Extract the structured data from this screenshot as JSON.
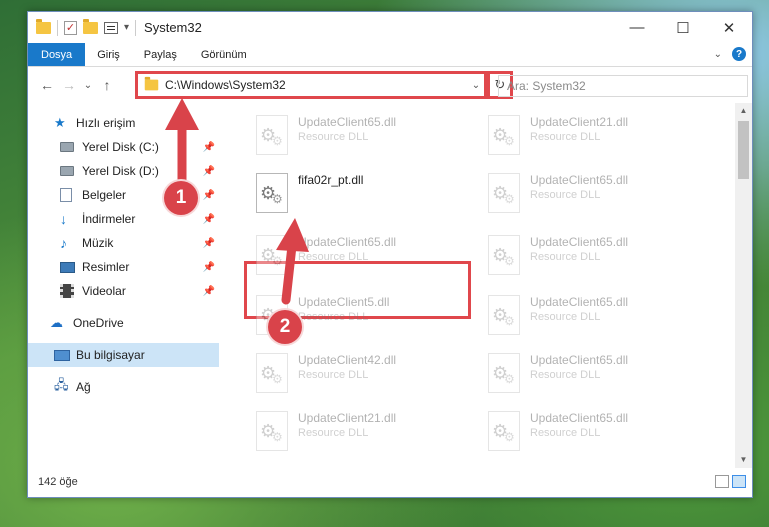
{
  "window": {
    "title": "System32"
  },
  "ribbon": {
    "tabs": [
      "Dosya",
      "Giriş",
      "Paylaş",
      "Görünüm"
    ],
    "help": "?"
  },
  "nav": {
    "back": "←",
    "forward": "→",
    "recent": "⌄",
    "up": "↑",
    "address": "C:\\Windows\\System32",
    "search_placeholder": "Ara: System32"
  },
  "sidebar": {
    "quick_access": "Hızlı erişim",
    "items": [
      {
        "label": "Yerel Disk (C:)",
        "icon": "drive-icon"
      },
      {
        "label": "Yerel Disk (D:)",
        "icon": "drive-icon"
      },
      {
        "label": "Belgeler",
        "icon": "documents-icon"
      },
      {
        "label": "İndirmeler",
        "icon": "downloads-icon"
      },
      {
        "label": "Müzik",
        "icon": "music-icon"
      },
      {
        "label": "Resimler",
        "icon": "pictures-icon"
      },
      {
        "label": "Videolar",
        "icon": "videos-icon"
      }
    ],
    "onedrive": "OneDrive",
    "this_pc": "Bu bilgisayar",
    "network": "Ağ"
  },
  "files": {
    "left": [
      {
        "name": "UpdateClient65.dll",
        "desc": "Resource DLL"
      },
      {
        "name": "fifa02r_pt.dll",
        "desc": ""
      },
      {
        "name": "UpdateClient65.dll",
        "desc": "Resource DLL"
      },
      {
        "name": "UpdateClient5.dll",
        "desc": "Resource DLL"
      },
      {
        "name": "UpdateClient42.dll",
        "desc": "Resource DLL"
      },
      {
        "name": "UpdateClient21.dll",
        "desc": "Resource DLL"
      }
    ],
    "right": [
      {
        "name": "UpdateClient21.dll",
        "desc": "Resource DLL"
      },
      {
        "name": "UpdateClient65.dll",
        "desc": "Resource DLL"
      },
      {
        "name": "UpdateClient65.dll",
        "desc": "Resource DLL"
      },
      {
        "name": "UpdateClient65.dll",
        "desc": "Resource DLL"
      },
      {
        "name": "UpdateClient65.dll",
        "desc": "Resource DLL"
      },
      {
        "name": "UpdateClient65.dll",
        "desc": "Resource DLL"
      }
    ]
  },
  "status": {
    "count": "142 öğe"
  },
  "annotations": {
    "step1": "1",
    "step2": "2",
    "color": "#d9434a"
  }
}
